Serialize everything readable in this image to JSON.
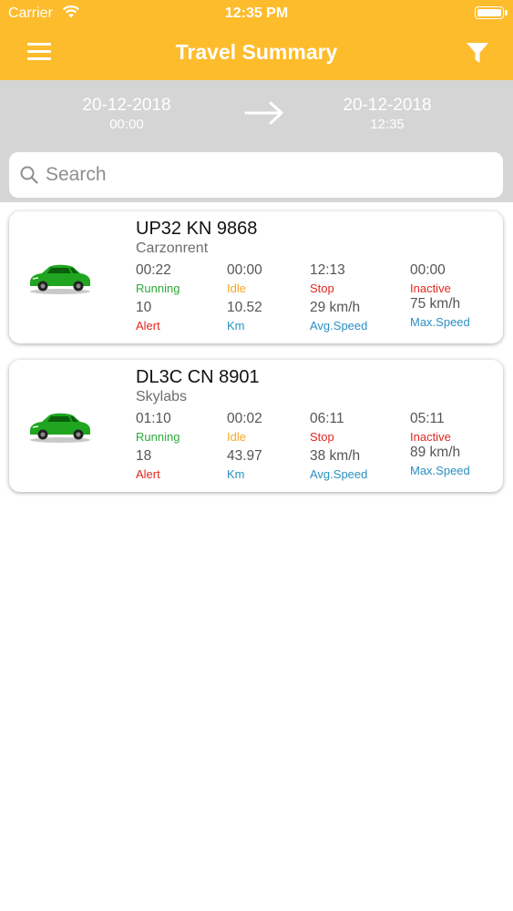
{
  "status_bar": {
    "carrier": "Carrier",
    "time": "12:35 PM"
  },
  "nav": {
    "title": "Travel Summary",
    "menu_icon": "hamburger-menu-icon",
    "filter_icon": "filter-funnel-icon"
  },
  "date_range": {
    "from": {
      "date": "20-12-2018",
      "time": "00:00"
    },
    "to": {
      "date": "20-12-2018",
      "time": "12:35"
    }
  },
  "search": {
    "placeholder": "Search",
    "value": ""
  },
  "colors": {
    "header": "#FDBC2C",
    "date_bar": "#D5D5D5",
    "running": "#2DAA3A",
    "idle": "#F5A623",
    "alert": "#E0281F",
    "speed": "#2B8FC4",
    "car": "#1FA51F"
  },
  "vehicles": [
    {
      "plate": "UP32 KN 9868",
      "company": "Carzonrent",
      "running": {
        "value": "00:22",
        "label": "Running"
      },
      "idle": {
        "value": "00:00",
        "label": "Idle"
      },
      "stop": {
        "value": "12:13",
        "label": "Stop"
      },
      "inactive": {
        "value": "00:00",
        "label": "Inactive"
      },
      "alert": {
        "value": "10",
        "label": "Alert"
      },
      "km": {
        "value": "10.52",
        "label": "Km"
      },
      "avg_speed": {
        "value": "29 km/h",
        "label": "Avg.Speed"
      },
      "max_speed": {
        "value": "75 km/h",
        "label": "Max.Speed"
      }
    },
    {
      "plate": "DL3C CN 8901",
      "company": "Skylabs",
      "running": {
        "value": "01:10",
        "label": "Running"
      },
      "idle": {
        "value": "00:02",
        "label": "Idle"
      },
      "stop": {
        "value": "06:11",
        "label": "Stop"
      },
      "inactive": {
        "value": "05:11",
        "label": "Inactive"
      },
      "alert": {
        "value": "18",
        "label": "Alert"
      },
      "km": {
        "value": "43.97",
        "label": "Km"
      },
      "avg_speed": {
        "value": "38 km/h",
        "label": "Avg.Speed"
      },
      "max_speed": {
        "value": "89 km/h",
        "label": "Max.Speed"
      }
    }
  ]
}
